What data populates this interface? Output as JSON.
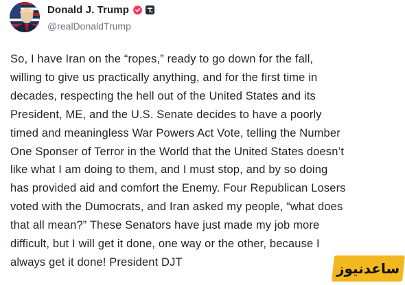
{
  "author": {
    "display_name": "Donald J. Trump",
    "handle": "@realDonaldTrump",
    "avatar_icon": "profile-avatar",
    "verified_icon": "verified-badge-icon",
    "platform_icon": "truth-social-icon",
    "verified_color": "#f4375f"
  },
  "post": {
    "lines": [
      "So, I have Iran on the “ropes,” ready to go down for the fall,",
      "willing to give us practically anything, and for the first time in",
      "decades, respecting the hell out of the United States and its",
      "President, ME, and the U.S. Senate decides to have a poorly",
      "timed and meaningless War Powers Act Vote, telling the Number",
      "One Sponser of Terror in the World that the United States doesn’t",
      "like what I am doing to them, and I must stop, and by so doing",
      "has provided aid and comfort the Enemy. Four Republican Losers",
      "voted with the Dumocrats, and Iran asked my people, “what does",
      "that all mean?” These Senators have just made my job more",
      "difficult, but I will get it done, one way or the other, because I",
      "always get it done! President DJT"
    ]
  },
  "watermark": {
    "text": "ساعدنیوز",
    "color": "#f3b81f"
  }
}
